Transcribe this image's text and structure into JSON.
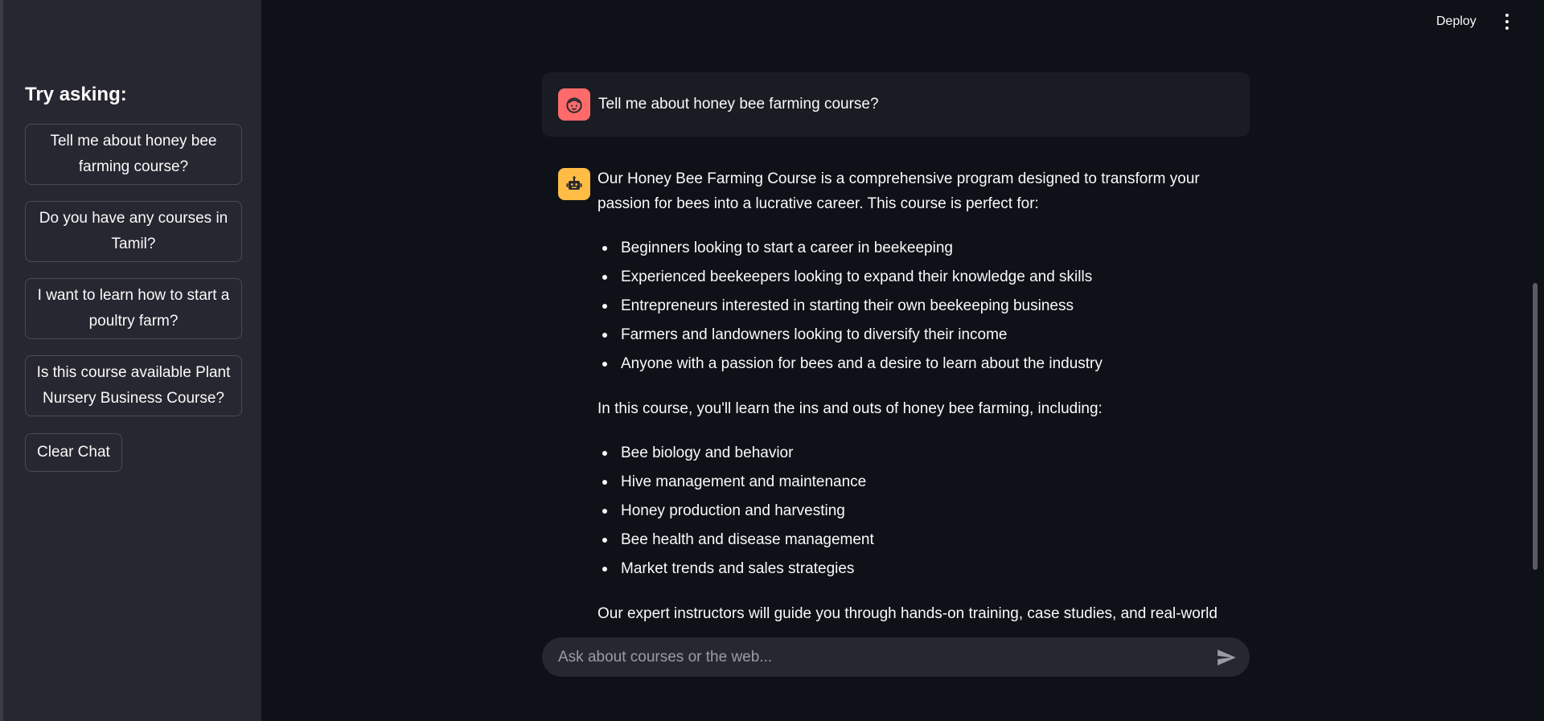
{
  "header": {
    "deploy_label": "Deploy",
    "menu_icon": "more-vertical-icon"
  },
  "sidebar": {
    "title": "Try asking:",
    "suggestions": [
      {
        "label": "Tell me about honey bee farming course?"
      },
      {
        "label": "Do you have any courses in Tamil?"
      },
      {
        "label": "I want to learn how to start a poultry farm?"
      },
      {
        "label": "Is this course available Plant Nursery Business Course?"
      }
    ],
    "clear_label": "Clear Chat"
  },
  "chat": {
    "user_avatar_icon": "user-face-icon",
    "bot_avatar_icon": "robot-icon",
    "user_message": "Tell me about honey bee farming course?",
    "bot_intro": "Our Honey Bee Farming Course is a comprehensive program designed to transform your passion for bees into a lucrative career. This course is perfect for:",
    "audience": [
      "Beginners looking to start a career in beekeeping",
      "Experienced beekeepers looking to expand their knowledge and skills",
      "Entrepreneurs interested in starting their own beekeeping business",
      "Farmers and landowners looking to diversify their income",
      "Anyone with a passion for bees and a desire to learn about the industry"
    ],
    "topics_intro": "In this course, you'll learn the ins and outs of honey bee farming, including:",
    "topics": [
      "Bee biology and behavior",
      "Hive management and maintenance",
      "Honey production and harvesting",
      "Bee health and disease management",
      "Market trends and sales strategies"
    ],
    "closing": "Our expert instructors will guide you through hands-on training, case studies, and real-world"
  },
  "input": {
    "placeholder": "Ask about courses or the web...",
    "send_icon": "send-icon"
  },
  "colors": {
    "background": "#0e1117",
    "sidebar": "#262730",
    "user_avatar": "#ff6b6b",
    "bot_avatar": "#ffbd45"
  }
}
